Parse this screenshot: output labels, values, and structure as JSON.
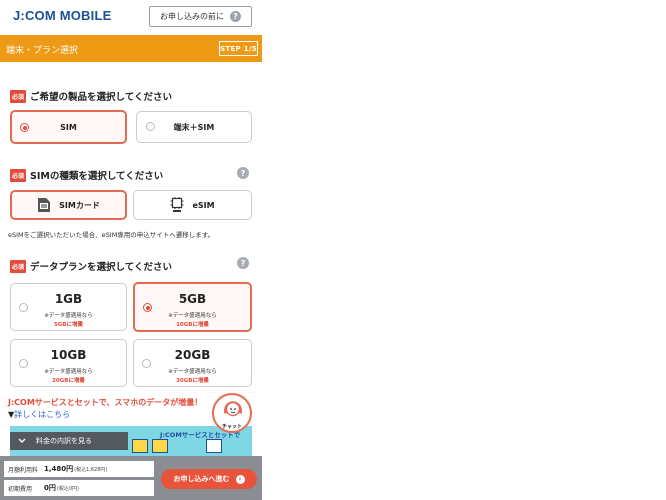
{
  "header": {
    "logo": "J:COM MOBILE",
    "before_apply": "お申し込みの前に"
  },
  "stepbar": {
    "title": "端末・プラン選択",
    "step": "STEP 1/5"
  },
  "required_badge": "必須",
  "product": {
    "question": "ご希望の製品を選択してください",
    "options": [
      {
        "label": "SIM",
        "selected": true
      },
      {
        "label": "端末＋SIM",
        "selected": false
      }
    ]
  },
  "sim_type": {
    "question": "SIMの種類を選択してください",
    "options": [
      {
        "label": "SIMカード",
        "icon": "sim-card-icon",
        "selected": true
      },
      {
        "label": "eSIM",
        "icon": "esim-chip-icon",
        "selected": false
      }
    ],
    "note": "eSIMをご選択いただいた場合、eSIM専用の申込サイトへ遷移します。"
  },
  "plan": {
    "question": "データプランを選択してください",
    "options": [
      {
        "gb": "1GB",
        "sub": "※データ盛適用なら",
        "upgrade": "5GBに増量",
        "selected": false
      },
      {
        "gb": "5GB",
        "sub": "※データ盛適用なら",
        "upgrade": "10GBに増量",
        "selected": true
      },
      {
        "gb": "10GB",
        "sub": "※データ盛適用なら",
        "upgrade": "20GBに増量",
        "selected": false
      },
      {
        "gb": "20GB",
        "sub": "※データ盛適用なら",
        "upgrade": "30GBに増量",
        "selected": false
      }
    ]
  },
  "promo": {
    "text": "J:COMサービスとセットで、スマホのデータが増量！",
    "link": "詳しくはこちら",
    "banner_text": "J:COMサービスとセットで",
    "fee_toggle": "料金の内訳を見る"
  },
  "chat": {
    "label": "チャット"
  },
  "footer": {
    "monthly_label": "月額利用料",
    "monthly_value": "1,480円",
    "monthly_tax": "(税込1,628円)",
    "initial_label": "初期費用",
    "initial_value": "0円",
    "initial_tax": "(税込0円)",
    "cta": "お申し込みへ進む"
  },
  "colors": {
    "accent": "#ee9a14",
    "selected_border": "#e56a53",
    "required": "#e24c3a",
    "brand": "#1d4f9a"
  }
}
